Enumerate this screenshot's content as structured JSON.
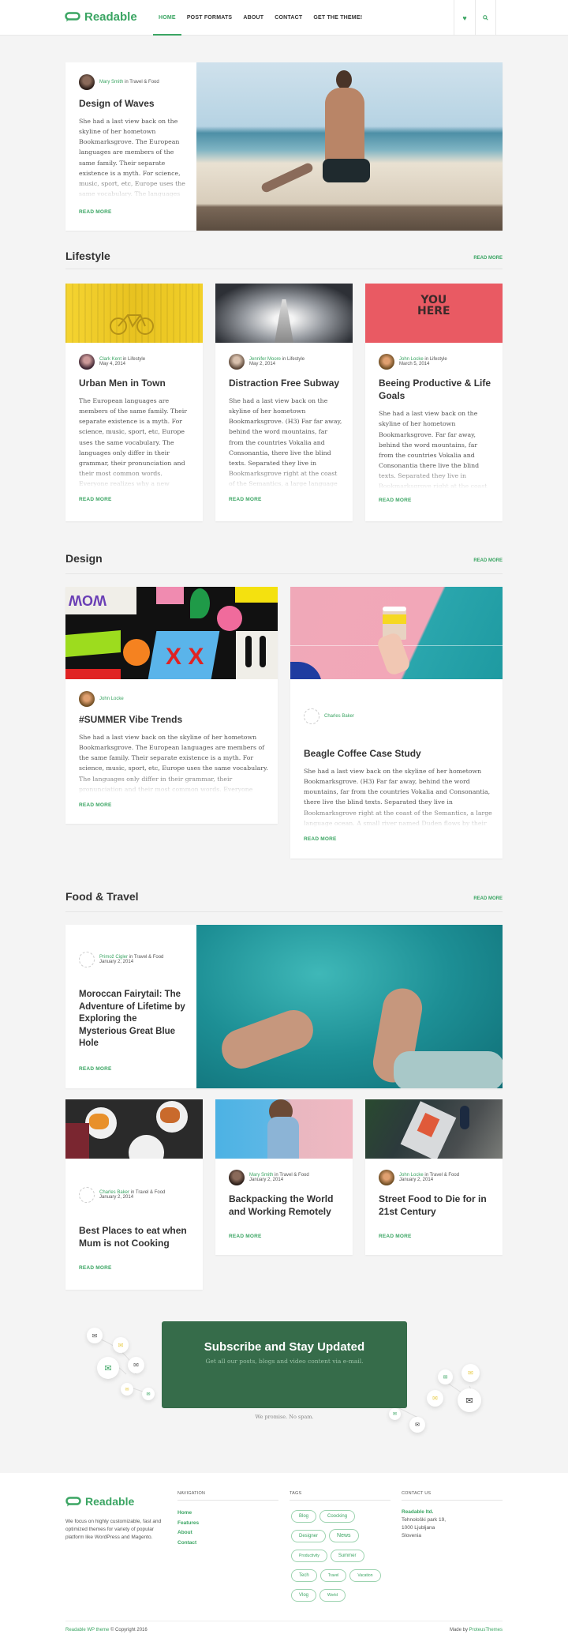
{
  "header": {
    "logo_text": "Readable",
    "nav": [
      {
        "label": "HOME",
        "active": true
      },
      {
        "label": "POST FORMATS"
      },
      {
        "label": "ABOUT"
      },
      {
        "label": "CONTACT"
      },
      {
        "label": "GET THE THEME!"
      }
    ],
    "icons": [
      "heart-icon",
      "search-icon"
    ]
  },
  "featured": {
    "author": "Mary Smith",
    "in_label": "in",
    "category": "Travel & Food",
    "title": "Design of Waves",
    "excerpt": "She had a last view back on the skyline of her hometown Bookmarksgrove. The European languages are members of the same family. Their separate existence is a myth. For science, music, sport, etc, Europe uses the same vocabulary. The languages",
    "read_more": "READ MORE"
  },
  "sections": {
    "lifestyle": {
      "title": "Lifestyle",
      "read_more": "READ MORE",
      "posts": [
        {
          "author": "Clark Kent",
          "category": "Lifestyle",
          "date": "May 4, 2014",
          "title": "Urban Men in Town",
          "excerpt": "The European languages are members of the same family. Their separate existence is a myth. For science, music, sport, etc, Europe uses the same vocabulary. The languages only differ in their grammar, their pronunciation and their most common words. Everyone realizes why a new",
          "read_more": "READ MORE"
        },
        {
          "author": "Jennifer Moore",
          "category": "Lifestyle",
          "date": "May 2, 2014",
          "title": "Distraction Free Subway",
          "excerpt": "She had a last view back on the skyline of her hometown Bookmarksgrove. (H3) Far far away, behind the word mountains, far from the countries Vokalia and Consonantia, there live the blind texts. Separated they live in Bookmarksgrove right at the coast of the Semantics, a large language",
          "read_more": "READ MORE"
        },
        {
          "author": "John Locke",
          "category": "Lifestyle",
          "date": "March 5, 2014",
          "title": "Beeing Productive & Life Goals",
          "excerpt": "She had a last view back on the skyline of her hometown Bookmarksgrove. Far far away, behind the word mountains, far from the countries Vokalia and Consonantia there live the blind texts. Separated they live in Bookmarksgrove right at the coast",
          "read_more": "READ MORE"
        }
      ]
    },
    "design": {
      "title": "Design",
      "read_more": "READ MORE",
      "posts": [
        {
          "author": "John Locke",
          "title": "#SUMMER Vibe Trends",
          "excerpt": "She had a last view back on the skyline of her hometown Bookmarksgrove. The European languages are members of the same family. Their separate existence is a myth. For science, music, sport, etc, Europe uses the same vocabulary. The languages only differ in their grammar, their pronunciation and their most common words. Everyone",
          "read_more": "READ MORE"
        },
        {
          "author": "Charles Baker",
          "title": "Beagle Coffee Case Study",
          "excerpt": "She had a last view back on the skyline of her hometown Bookmarksgrove. (H3) Far far away, behind the word mountains, far from the countries Vokalia and Consonantia, there live the blind texts. Separated they live in Bookmarksgrove right at the coast of the Semantics, a large language ocean. A small river named Duden flows by their",
          "read_more": "READ MORE"
        }
      ]
    },
    "food_travel": {
      "title": "Food & Travel",
      "read_more": "READ MORE",
      "featured": {
        "author": "Primož Cigler",
        "category": "Travel & Food",
        "date": "January 2, 2014",
        "title": "Moroccan Fairytail: The Adventure of Lifetime by Exploring the Mysterious Great Blue Hole",
        "read_more": "READ MORE"
      },
      "posts": [
        {
          "author": "Charles Baker",
          "category": "Travel & Food",
          "date": "January 2, 2014",
          "title": "Best Places to eat when Mum is not Cooking",
          "read_more": "READ MORE"
        },
        {
          "author": "Mary Smith",
          "category": "Travel & Food",
          "date": "January 2, 2014",
          "title": "Backpacking the World and Working Remotely",
          "read_more": "READ MORE"
        },
        {
          "author": "John Locke",
          "category": "Travel & Food",
          "date": "January 2, 2014",
          "title": "Street Food to Die for in 21st Century",
          "read_more": "READ MORE"
        }
      ]
    }
  },
  "subscribe": {
    "title": "Subscribe and Stay Updated",
    "subtitle": "Get all our posts, blogs and video content via e-mail.",
    "note": "We promise. No spam."
  },
  "footer": {
    "logo_text": "Readable",
    "about": "We focus on highly customizable, fast and optimized themes for variety of popular platform like WordPress and Magento.",
    "nav_heading": "NAVIGATION",
    "nav": [
      "Home",
      "Features",
      "About",
      "Contact"
    ],
    "tags_heading": "TAGS",
    "tags": [
      "Blog",
      "Coocking",
      "Designer",
      "News",
      "Productivity",
      "Summer",
      "Tech",
      "Travel",
      "Vacation",
      "Vlog",
      "World"
    ],
    "contact_heading": "CONTACT US",
    "contact_company": "Readable ltd.",
    "contact_lines": [
      "Tehnološki park 19,",
      "1000 Ljubljana",
      "Slovenia"
    ],
    "copyright_link": "Readable WP theme",
    "copyright_rest": "© Copyright 2016",
    "made_by_label": "Made by",
    "made_by_link": "ProteusThemes"
  },
  "colors": {
    "accent": "#3ba563",
    "subscribe_bg": "#366c4a",
    "background": "#f4f4f4"
  }
}
